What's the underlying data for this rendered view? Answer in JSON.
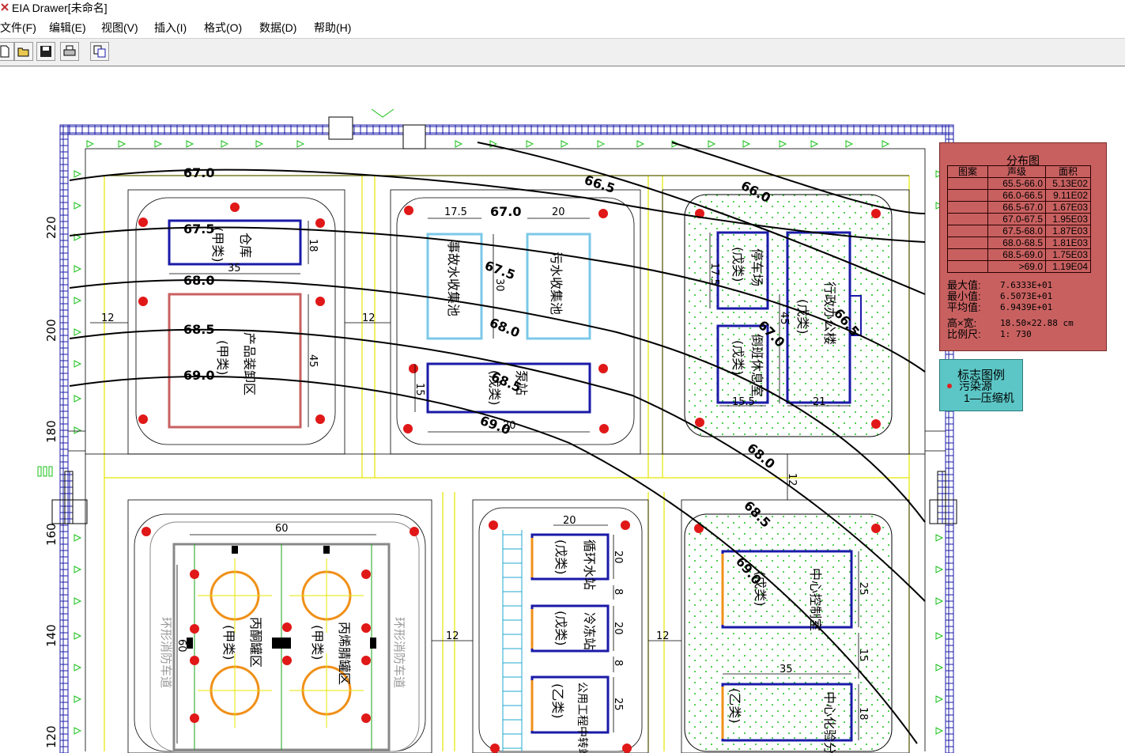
{
  "window": {
    "title": "EIA Drawer[未命名]"
  },
  "menu": [
    {
      "label": "文件(F)"
    },
    {
      "label": "编辑(E)"
    },
    {
      "label": "视图(V)"
    },
    {
      "label": "插入(I)"
    },
    {
      "label": "格式(O)"
    },
    {
      "label": "数据(D)"
    },
    {
      "label": "帮助(H)"
    }
  ],
  "toolbar": {
    "buttons": [
      {
        "icon": "new-file-icon"
      },
      {
        "icon": "open-folder-icon"
      },
      {
        "icon": "save-disk-icon"
      },
      {
        "icon": "print-icon"
      },
      {
        "icon": "copy-icon"
      }
    ]
  },
  "axis_labels": [
    "220",
    "200",
    "180",
    "160",
    "140",
    "120"
  ],
  "contours": [
    "67.0",
    "67.5",
    "68.0",
    "68.5",
    "69.0",
    "66.5",
    "67.0",
    "67.5",
    "68.0",
    "68.5",
    "69.0",
    "66.0",
    "66.5",
    "67.0",
    "68.0",
    "68.5",
    "69.0"
  ],
  "buildings": {
    "warehouse": {
      "name": "仓库",
      "cls": "(甲类)"
    },
    "product_tank": {
      "name": "产品装卸区",
      "cls": "(甲类)"
    },
    "water_pool": {
      "name": "事故水收集池"
    },
    "sewage_pool": {
      "name": "污水收集池"
    },
    "pump_station": {
      "name": "泵站",
      "cls": "(戊类)"
    },
    "garage": {
      "name": "停车场",
      "cls": "(戊类)"
    },
    "office": {
      "name": "行政办公楼",
      "cls": "(戊类)"
    },
    "lab": {
      "name": "倒班休息室",
      "cls": "(戊类)"
    },
    "tank_farm": {
      "name": "丙酮罐区",
      "cls": "(甲类)"
    },
    "tank_farm2": {
      "name": "丙烯腈罐区",
      "cls": "(甲类)"
    },
    "cooling": {
      "name": "循环水站",
      "cls": "(戊类)"
    },
    "freezer": {
      "name": "冷冻站",
      "cls": "(戊类)"
    },
    "public": {
      "name": "公用工程中转站",
      "cls": "(乙类)"
    },
    "control": {
      "name": "中心控制室",
      "cls": "(戊类)"
    },
    "analysis": {
      "name": "中心化验分析",
      "cls": "(乙类)"
    }
  },
  "dimensions": [
    "35",
    "18",
    "45",
    "12",
    "12",
    "17.5",
    "20",
    "30",
    "15",
    "15.5",
    "20",
    "45",
    "17.5",
    "21",
    "12",
    "60",
    "60",
    "12",
    "12",
    "20",
    "20",
    "20",
    "8",
    "8",
    "25",
    "25",
    "15",
    "35",
    "18"
  ],
  "side_labels": {
    "ring_road_left": "环形消防车道",
    "ring_road_right": "环形消防车道"
  },
  "distribution": {
    "title": "分布图",
    "headers": [
      "图案",
      "声级",
      "面积"
    ],
    "rows": [
      {
        "level": "65.5-66.0",
        "area": "5.13E02"
      },
      {
        "level": "66.0-66.5",
        "area": "9.11E02"
      },
      {
        "level": "66.5-67.0",
        "area": "1.67E03"
      },
      {
        "level": "67.0-67.5",
        "area": "1.95E03"
      },
      {
        "level": "67.5-68.0",
        "area": "1.87E03"
      },
      {
        "level": "68.0-68.5",
        "area": "1.81E03"
      },
      {
        "level": "68.5-69.0",
        "area": "1.75E03"
      },
      {
        "level": ">69.0",
        "area": "1.19E04"
      }
    ],
    "stats": [
      {
        "label": "最大值:",
        "value": "7.6333E+01"
      },
      {
        "label": "最小值:",
        "value": "6.5073E+01"
      },
      {
        "label": "平均值:",
        "value": "6.9439E+01"
      },
      {
        "label": "高×宽:",
        "value": "18.50×22.88 cm"
      },
      {
        "label": "比例尺:",
        "value": "1: 730"
      }
    ]
  },
  "legend": {
    "title": "标志图例",
    "name": "污染源",
    "value": "1—压缩机"
  },
  "colors": {
    "contour": "#000000",
    "building": "#1a1aa8",
    "fence": "#1a1aa8",
    "green": "#18c018",
    "road": "#e6e600",
    "panel_red": "#c86060",
    "panel_cyan": "#5cc6c6"
  }
}
